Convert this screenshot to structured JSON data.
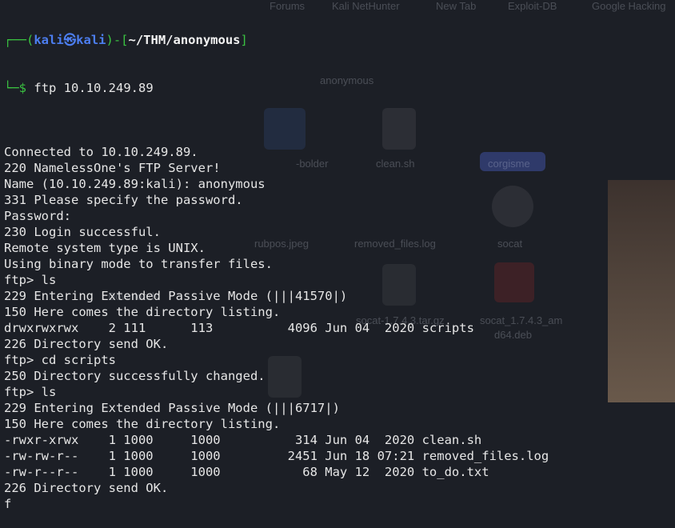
{
  "prompt": {
    "user": "kali",
    "sep": "㉿",
    "host": "kali",
    "cwd": "~/THM/anonymous",
    "dollar": "$",
    "command": "ftp 10.10.249.89"
  },
  "desktop": {
    "tabs": [
      "Forums",
      "Kali NetHunter",
      "New Tab",
      "Exploit-DB",
      "Google Hacking"
    ],
    "folder_name": "anonymous",
    "file_labels": [
      "clean.sh",
      "removed_files.log",
      "socat",
      "rubpos.jpeg",
      "socat-1.7.4.3.tar.gz",
      "socat_1.7.4.3_am",
      "d64.deb",
      "Downloads",
      "-bolder",
      "corgisme"
    ]
  },
  "lines": [
    "",
    "Connected to 10.10.249.89.",
    "220 NamelessOne's FTP Server!",
    "Name (10.10.249.89:kali): anonymous",
    "331 Please specify the password.",
    "Password:",
    "230 Login successful.",
    "Remote system type is UNIX.",
    "Using binary mode to transfer files.",
    "ftp> ls",
    "229 Entering Extended Passive Mode (|||41570|)",
    "150 Here comes the directory listing.",
    "drwxrwxrwx    2 111      113          4096 Jun 04  2020 scripts",
    "226 Directory send OK.",
    "ftp> cd scripts",
    "250 Directory successfully changed.",
    "ftp> ls",
    "229 Entering Extended Passive Mode (|||6717|)",
    "150 Here comes the directory listing.",
    "-rwxr-xrwx    1 1000     1000          314 Jun 04  2020 clean.sh",
    "-rw-rw-r--    1 1000     1000         2451 Jun 18 07:21 removed_files.log",
    "-rw-r--r--    1 1000     1000           68 May 12  2020 to_do.txt",
    "226 Directory send OK.",
    "f"
  ]
}
